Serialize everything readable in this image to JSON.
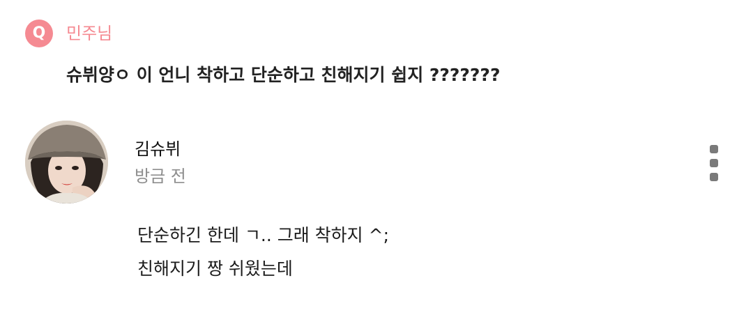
{
  "question": {
    "badge": "Q",
    "asker": "민주님",
    "text": "슈뷔양ㅇ 이 언니 착하고 단순하고 친해지기 쉽지 ???????"
  },
  "answer": {
    "author": "김슈뷔",
    "timestamp": "방금 전",
    "lines": [
      "단순하긴 한데 ㄱ.. 그래 착하지 ^;",
      "친해지기 짱 쉬웠는데"
    ]
  },
  "icons": {
    "more": "more-vertical-icon"
  },
  "colors": {
    "accent": "#f58a92",
    "muted": "#8e8e8e",
    "text": "#1f1f1f"
  }
}
